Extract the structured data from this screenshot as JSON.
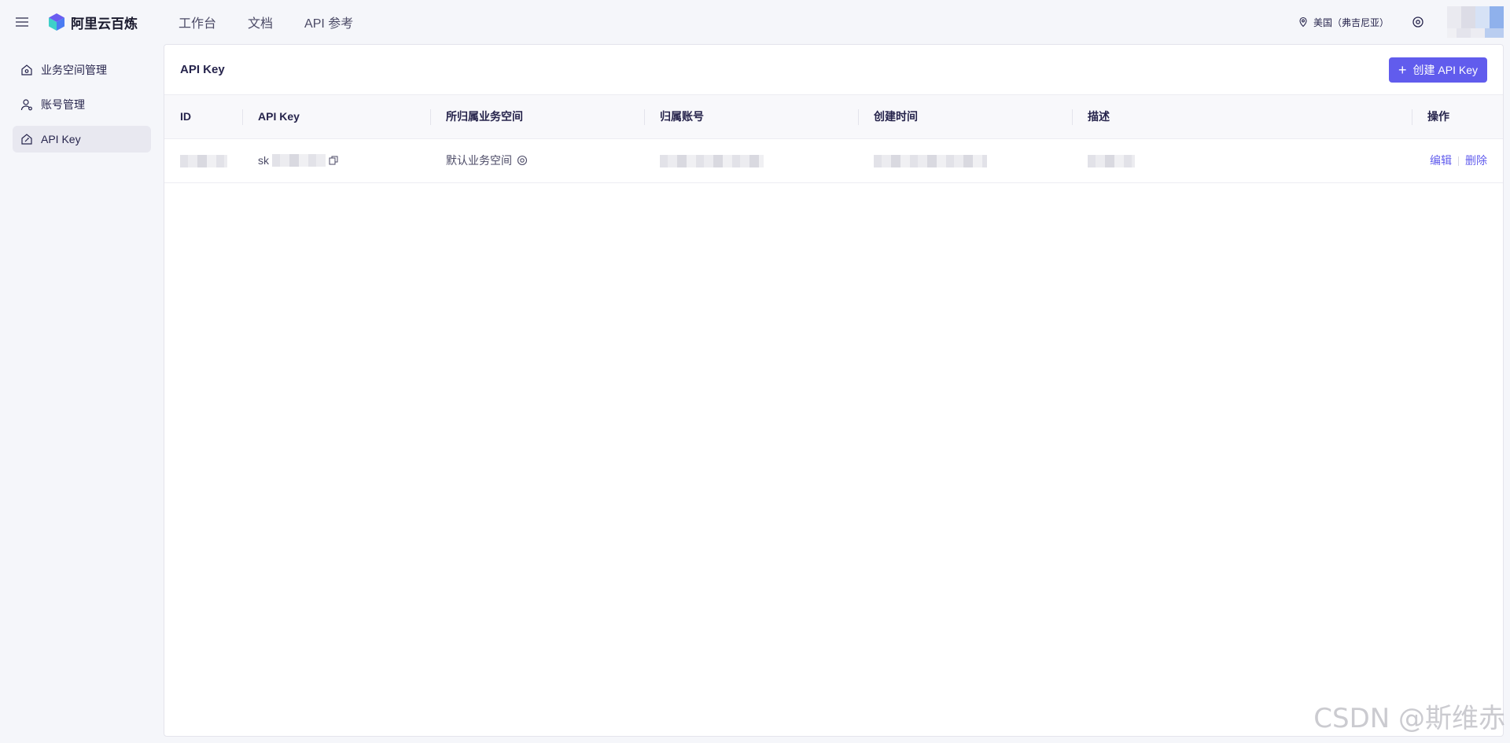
{
  "header": {
    "brand": "阿里云百炼",
    "nav": [
      "工作台",
      "文档",
      "API 参考"
    ],
    "region": "美国（弗吉尼亚）"
  },
  "sidebar": {
    "items": [
      {
        "label": "业务空间管理",
        "icon": "workspace-icon"
      },
      {
        "label": "账号管理",
        "icon": "user-icon"
      },
      {
        "label": "API Key",
        "icon": "key-house-icon",
        "active": true
      }
    ]
  },
  "main": {
    "title": "API Key",
    "create_button": "创建 API Key",
    "columns": [
      "ID",
      "API Key",
      "所归属业务空间",
      "归属账号",
      "创建时间",
      "描述",
      "操作"
    ],
    "rows": [
      {
        "api_key_prefix": "sk",
        "workspace": "默认业务空间",
        "actions": [
          "编辑",
          "删除"
        ]
      }
    ]
  },
  "watermark": "CSDN @斯维赤",
  "colors": {
    "accent": "#615ced",
    "text": "#26244c"
  }
}
